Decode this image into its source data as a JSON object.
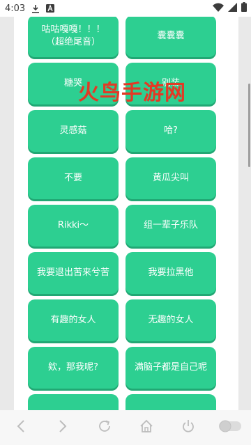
{
  "status_bar": {
    "time": "4:03",
    "icons": [
      "download-icon",
      "notification-a-icon",
      "wifi-icon",
      "signal-icon",
      "battery-icon"
    ]
  },
  "watermark": "火鸟手游网",
  "tiles": [
    {
      "label": "咕咕嘎嘎！！！\n（超绝尾音）"
    },
    {
      "label": "囊囊囊"
    },
    {
      "label": "糖哭"
    },
    {
      "label": "别装"
    },
    {
      "label": "灵感菇"
    },
    {
      "label": "哈?"
    },
    {
      "label": "不要"
    },
    {
      "label": "黄瓜尖叫"
    },
    {
      "label": "Rikki～"
    },
    {
      "label": "组一辈子乐队"
    },
    {
      "label": "我要退出苦来兮苦"
    },
    {
      "label": "我要拉黑他"
    },
    {
      "label": "有趣的女人"
    },
    {
      "label": "无趣的女人"
    },
    {
      "label": "欸，那我呢?"
    },
    {
      "label": "满脑子都是自己呢"
    },
    {
      "label": ""
    },
    {
      "label": ""
    }
  ],
  "colors": {
    "tile": "#2dcf91",
    "tile_shadow": "#21a874",
    "watermark": "#e23a25"
  },
  "nav_bar": {
    "icons": [
      "back-arrow-icon",
      "forward-arrow-icon",
      "refresh-icon",
      "home-icon",
      "power-icon",
      "toggle-switch-icon"
    ]
  }
}
